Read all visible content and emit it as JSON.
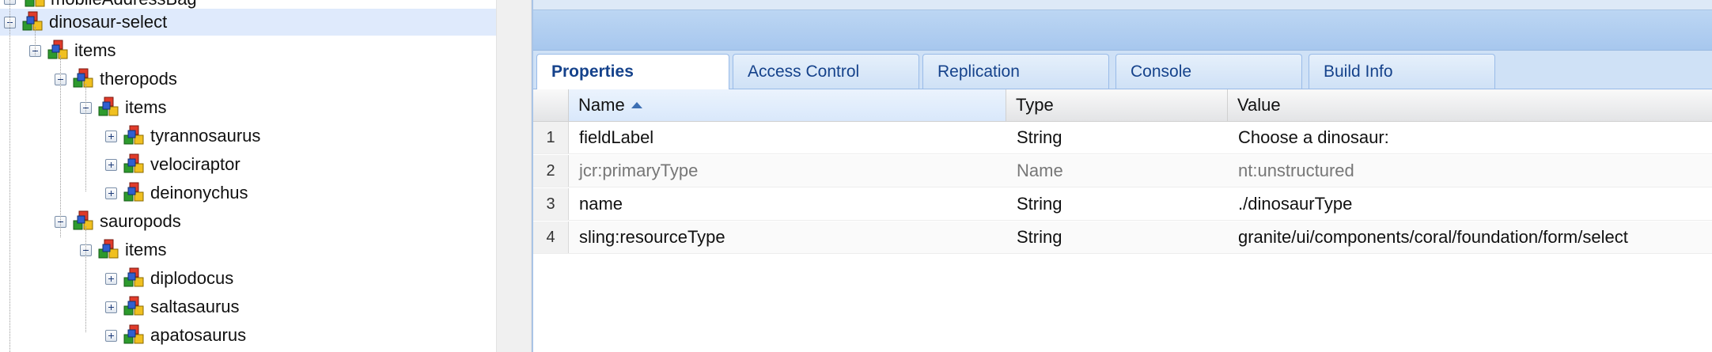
{
  "tree": {
    "cut_top_label": "mobileAddressBag",
    "nodes": [
      {
        "label": "dinosaur-select",
        "toggle": "minus",
        "selected": true
      },
      {
        "label": "items",
        "toggle": "minus"
      },
      {
        "label": "theropods",
        "toggle": "minus"
      },
      {
        "label": "items",
        "toggle": "minus"
      },
      {
        "label": "tyrannosaurus",
        "toggle": "plus"
      },
      {
        "label": "velociraptor",
        "toggle": "plus"
      },
      {
        "label": "deinonychus",
        "toggle": "plus"
      },
      {
        "label": "sauropods",
        "toggle": "minus"
      },
      {
        "label": "items",
        "toggle": "minus"
      },
      {
        "label": "diplodocus",
        "toggle": "plus"
      },
      {
        "label": "saltasaurus",
        "toggle": "plus"
      },
      {
        "label": "apatosaurus",
        "toggle": "plus"
      }
    ]
  },
  "tabs": [
    "Properties",
    "Access Control",
    "Replication",
    "Console",
    "Build Info"
  ],
  "active_tab": "Properties",
  "grid": {
    "columns": [
      "Name",
      "Type",
      "Value"
    ],
    "sorted_column": "Name",
    "sort_direction": "ascending",
    "rows": [
      {
        "num": "1",
        "name": "fieldLabel",
        "type": "String",
        "value": "Choose a dinosaur:",
        "dim": false
      },
      {
        "num": "2",
        "name": "jcr:primaryType",
        "type": "Name",
        "value": "nt:unstructured",
        "dim": true
      },
      {
        "num": "3",
        "name": "name",
        "type": "String",
        "value": "./dinosaurType",
        "dim": false
      },
      {
        "num": "4",
        "name": "sling:resourceType",
        "type": "String",
        "value": "granite/ui/components/coral/foundation/form/select",
        "dim": false
      }
    ]
  },
  "colors": {
    "selection": "#dfeafc",
    "tab_text": "#15428b",
    "panel_blue": "#cfe1f6"
  },
  "icons": {
    "tree_toggle_minus": "collapse-icon",
    "tree_toggle_plus": "expand-icon",
    "tree_node": "node-cubes-icon",
    "sort": "sort-ascending-icon"
  }
}
